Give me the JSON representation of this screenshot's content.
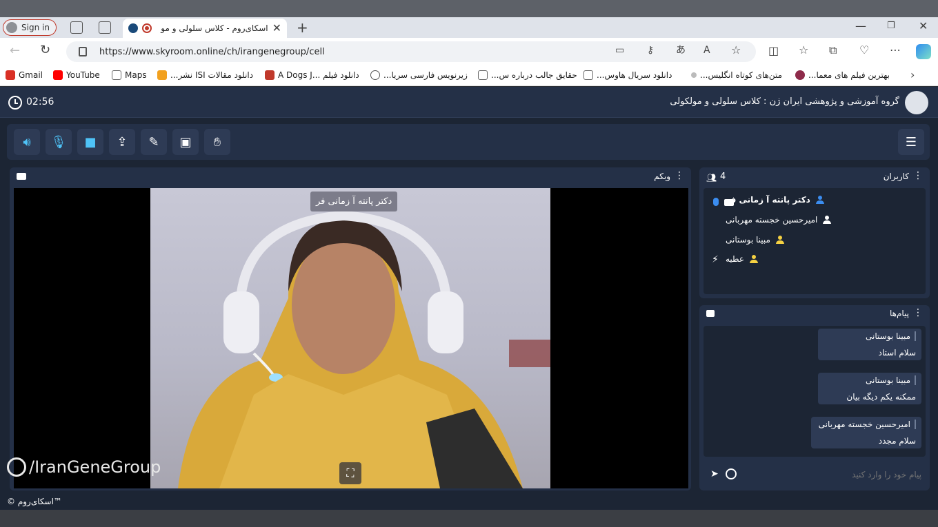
{
  "browser": {
    "sign_in": "Sign in",
    "tab_title": "اسکای‌روم - کلاس سلولی و مو",
    "url": "https://www.skyroom.online/ch/irangenegroup/cell",
    "bookmarks": [
      {
        "label": "Gmail",
        "color": "#d93025"
      },
      {
        "label": "YouTube",
        "color": "#ff0000"
      },
      {
        "label": "Maps",
        "color": "#666666"
      },
      {
        "label": "دانلود مقالات ISI نشر...",
        "color": "#f2a11f"
      },
      {
        "label": "A Dogs J... دانلود فیلم",
        "color": "#c0392b"
      },
      {
        "label": "زیرنویس فارسی سریا...",
        "color": "#555555"
      },
      {
        "label": "حقایق جالب درباره س...",
        "color": "#666666"
      },
      {
        "label": "دانلود سریال هاوس...",
        "color": "#666666"
      },
      {
        "label": "متن‌های کوتاه انگلیس...",
        "color": "#999999"
      },
      {
        "label": "بهترین فیلم های معما...",
        "color": "#8e2b4a"
      }
    ]
  },
  "app": {
    "timer": "02:56",
    "title": "گروه آموزشی و پژوهشی ایران ژن : کلاس سلولی و مولکولی",
    "webcam_panel_title": "وبکم",
    "presenter_name": "دکتر پانته آ زمانی فر",
    "watermark": "/IranGeneGroup",
    "users_panel_title": "کاربران",
    "users_count": "4",
    "users": [
      {
        "name": "دکتر پانته آ زمانی فر",
        "icon_color": "#3b8df0",
        "bold": true
      },
      {
        "name": "امیرحسین خجسته مهربانی",
        "icon_color": "#ffffff",
        "bold": false
      },
      {
        "name": "مبینا بوستانی",
        "icon_color": "#f5d142",
        "bold": false
      },
      {
        "name": "عطیه",
        "icon_color": "#f5d142",
        "bold": false
      }
    ],
    "messages_panel_title": "پیام‌ها",
    "messages": [
      {
        "sender": "مبینا بوستانی",
        "text": "سلام استاد"
      },
      {
        "sender": "مبینا بوستانی",
        "text": "ممکنه یکم دیگه بیان"
      },
      {
        "sender": "امیرحسین خجسته مهربانی",
        "text": "سلام مجدد"
      }
    ],
    "message_placeholder": "پیام خود را وارد کنید",
    "footer": "© اسکای‌روم™"
  }
}
